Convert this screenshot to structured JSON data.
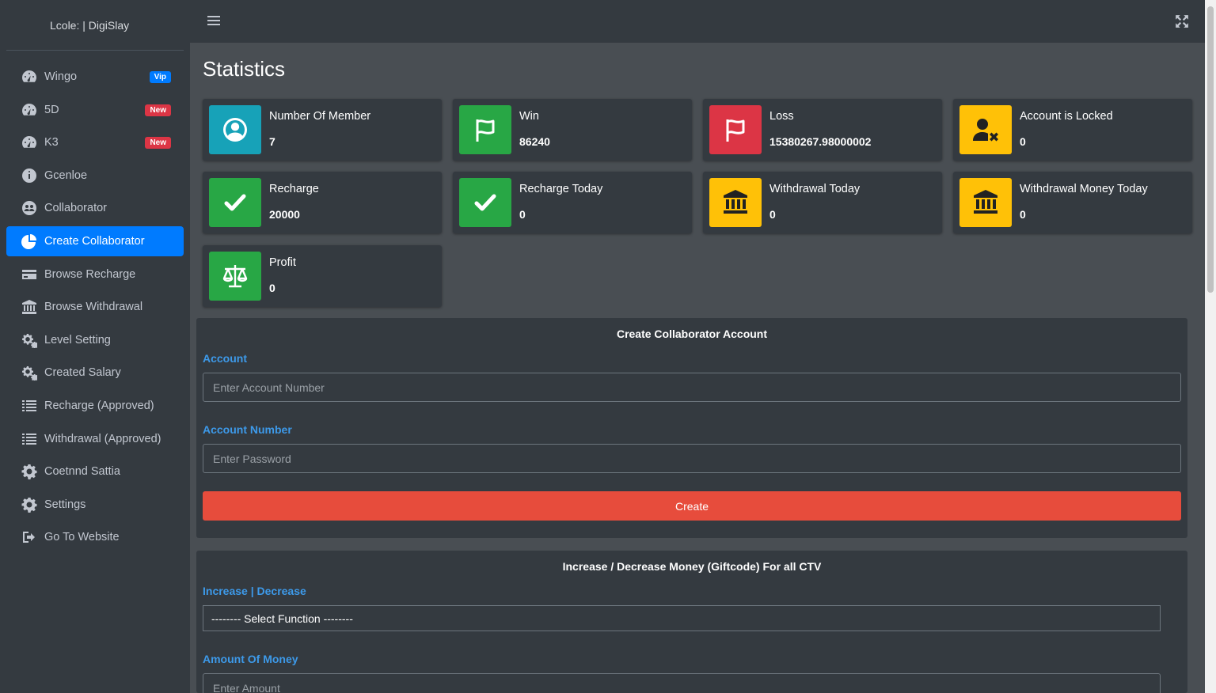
{
  "brand": {
    "title": "Lcole: | DigiSlay"
  },
  "sidebar": {
    "items": [
      {
        "label": "Wingo",
        "icon": "tachometer-icon",
        "badge": "Vip",
        "active": false
      },
      {
        "label": "5D",
        "icon": "tachometer-icon",
        "badge": "New",
        "active": false
      },
      {
        "label": "K3",
        "icon": "tachometer-icon",
        "badge": "New",
        "active": false
      },
      {
        "label": "Gcenloe",
        "icon": "gauge-icon",
        "badge": "",
        "active": false
      },
      {
        "label": "Collaborator",
        "icon": "users-icon",
        "badge": "",
        "active": false
      },
      {
        "label": "Create Collaborator",
        "icon": "pie-chart-icon",
        "badge": "",
        "active": true
      },
      {
        "label": "Browse Recharge",
        "icon": "credit-card-icon",
        "badge": "",
        "active": false
      },
      {
        "label": "Browse Withdrawal",
        "icon": "bank-icon",
        "badge": "",
        "active": false
      },
      {
        "label": "Level Setting",
        "icon": "cogs-icon",
        "badge": "",
        "active": false
      },
      {
        "label": "Created Salary",
        "icon": "cogs-icon",
        "badge": "",
        "active": false
      },
      {
        "label": "Recharge (Approved)",
        "icon": "list-icon",
        "badge": "",
        "active": false
      },
      {
        "label": "Withdrawal (Approved)",
        "icon": "list-icon",
        "badge": "",
        "active": false
      },
      {
        "label": "Coetnnd Sattia",
        "icon": "gear-icon",
        "badge": "",
        "active": false
      },
      {
        "label": "Settings",
        "icon": "gear-icon",
        "badge": "",
        "active": false
      },
      {
        "label": "Go To Website",
        "icon": "sign-out-icon",
        "badge": "",
        "active": false
      }
    ]
  },
  "header": {
    "menu_icon": "hamburger-icon",
    "expand_icon": "expand-icon"
  },
  "main": {
    "title": "Statistics",
    "stats": [
      {
        "label": "Number Of Member",
        "value": "7",
        "icon": "user-circle-icon",
        "color": "#17a2b8"
      },
      {
        "label": "Win",
        "value": "86240",
        "icon": "flag-icon",
        "color": "#28a745"
      },
      {
        "label": "Loss",
        "value": "15380267.98000002",
        "icon": "flag-icon",
        "color": "#dc3545"
      },
      {
        "label": "Account is Locked",
        "value": "0",
        "icon": "user-times-icon",
        "color": "#ffc107"
      },
      {
        "label": "Recharge",
        "value": "20000",
        "icon": "check-icon",
        "color": "#28a745"
      },
      {
        "label": "Recharge Today",
        "value": "0",
        "icon": "check-icon",
        "color": "#28a745"
      },
      {
        "label": "Withdrawal Today",
        "value": "0",
        "icon": "bank-icon",
        "color": "#ffc107"
      },
      {
        "label": "Withdrawal Money Today",
        "value": "0",
        "icon": "bank-icon",
        "color": "#ffc107"
      },
      {
        "label": "Profit",
        "value": "0",
        "icon": "balance-scale-icon",
        "color": "#28a745"
      }
    ],
    "create_form": {
      "title": "Create Collaborator Account",
      "account_label": "Account",
      "account_placeholder": "Enter Account Number",
      "password_label": "Account Number",
      "password_placeholder": "Enter Password",
      "submit_label": "Create"
    },
    "money_form": {
      "title": "Increase / Decrease Money (Giftcode) For all CTV",
      "function_label": "Increase | Decrease",
      "function_selected": "-------- Select Function --------",
      "amount_label": "Amount Of Money",
      "amount_placeholder": "Enter Amount"
    }
  }
}
